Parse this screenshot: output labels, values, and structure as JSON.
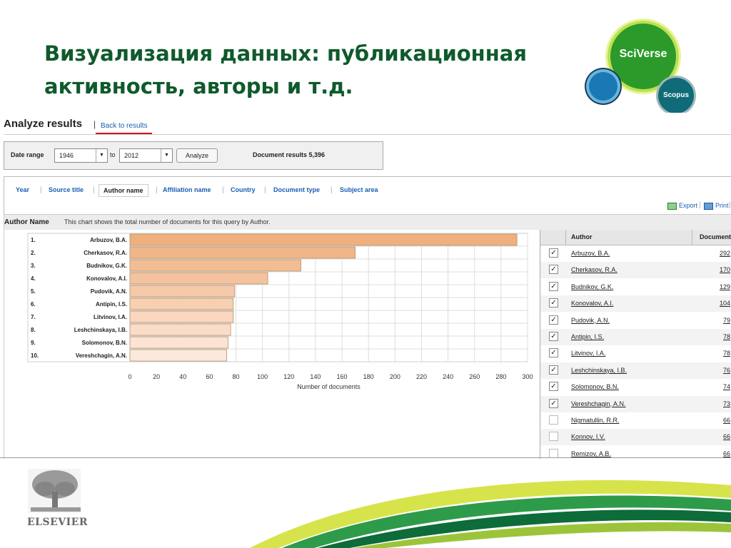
{
  "slide": {
    "title_line1": "Визуализация данных: публикационная",
    "title_line2": "активность, авторы и т.д.",
    "logo_sciverse": "SciVerse",
    "logo_scopus": "Scopus",
    "publisher": "ELSEVIER"
  },
  "header": {
    "title": "Analyze results",
    "separator": "|",
    "back_link": "Back to results"
  },
  "filters": {
    "date_range_label": "Date range",
    "from_value": "1946",
    "to_label": "to",
    "to_value": "2012",
    "analyze_button": "Analyze",
    "document_results": "Document results 5,396"
  },
  "tabs": [
    {
      "label": "Year",
      "active": false
    },
    {
      "label": "Source title",
      "active": false
    },
    {
      "label": "Author name",
      "active": true
    },
    {
      "label": "Affiliation name",
      "active": false
    },
    {
      "label": "Country",
      "active": false
    },
    {
      "label": "Document type",
      "active": false
    },
    {
      "label": "Subject area",
      "active": false
    }
  ],
  "actions": {
    "export": "Export",
    "print": "Print"
  },
  "analysis": {
    "name": "Author Name",
    "description": "This chart shows the total number of documents for this query by Author."
  },
  "chart_data": {
    "type": "bar",
    "orientation": "horizontal",
    "categories": [
      "1.",
      "2.",
      "3.",
      "4.",
      "5.",
      "6.",
      "7.",
      "8.",
      "9.",
      "10."
    ],
    "labels": [
      "Arbuzov, B.A.",
      "Cherkasov, R.A.",
      "Budnikov, G.K.",
      "Konovalov, A.I.",
      "Pudovik, A.N.",
      "Antipin, I.S.",
      "Litvinov, I.A.",
      "Leshchinskaya, I.B.",
      "Solomonov, B.N.",
      "Vereshchagin, A.N."
    ],
    "values": [
      292,
      170,
      129,
      104,
      79,
      78,
      78,
      76,
      74,
      73
    ],
    "xlabel": "Number of documents",
    "xlim": [
      0,
      300
    ],
    "xticks": [
      0,
      20,
      40,
      60,
      80,
      100,
      120,
      140,
      160,
      180,
      200,
      220,
      240,
      260,
      280,
      300
    ],
    "grid": true,
    "colors": {
      "bar_dark": "#f0b07e",
      "bar_light": "#fde9dc",
      "bar_border": "#b0916f",
      "grid": "#dddddd"
    }
  },
  "table": {
    "col_author": "Author",
    "col_docs": "Documents",
    "rows": [
      {
        "author": "Arbuzov, B.A.",
        "docs": "292",
        "checked": true
      },
      {
        "author": "Cherkasov, R.A.",
        "docs": "170",
        "checked": true
      },
      {
        "author": "Budnikov, G.K.",
        "docs": "129",
        "checked": true
      },
      {
        "author": "Konovalov, A.I.",
        "docs": "104",
        "checked": true
      },
      {
        "author": "Pudovik, A.N.",
        "docs": "79",
        "checked": true
      },
      {
        "author": "Antipin, I.S.",
        "docs": "78",
        "checked": true
      },
      {
        "author": "Litvinov, I.A.",
        "docs": "78",
        "checked": true
      },
      {
        "author": "Leshchinskaya, I.B.",
        "docs": "76",
        "checked": true
      },
      {
        "author": "Solomonov, B.N.",
        "docs": "74",
        "checked": true
      },
      {
        "author": "Vereshchagin, A.N.",
        "docs": "73",
        "checked": true
      },
      {
        "author": "Nigmatullin, R.R.",
        "docs": "66",
        "checked": false
      },
      {
        "author": "Konnov, I.V.",
        "docs": "66",
        "checked": false
      },
      {
        "author": "Remizov, A.B.",
        "docs": "66",
        "checked": false
      }
    ]
  },
  "colors": {
    "title": "#0f5a2c",
    "link": "#1a5fb4",
    "underline_accent": "#d2151b"
  }
}
